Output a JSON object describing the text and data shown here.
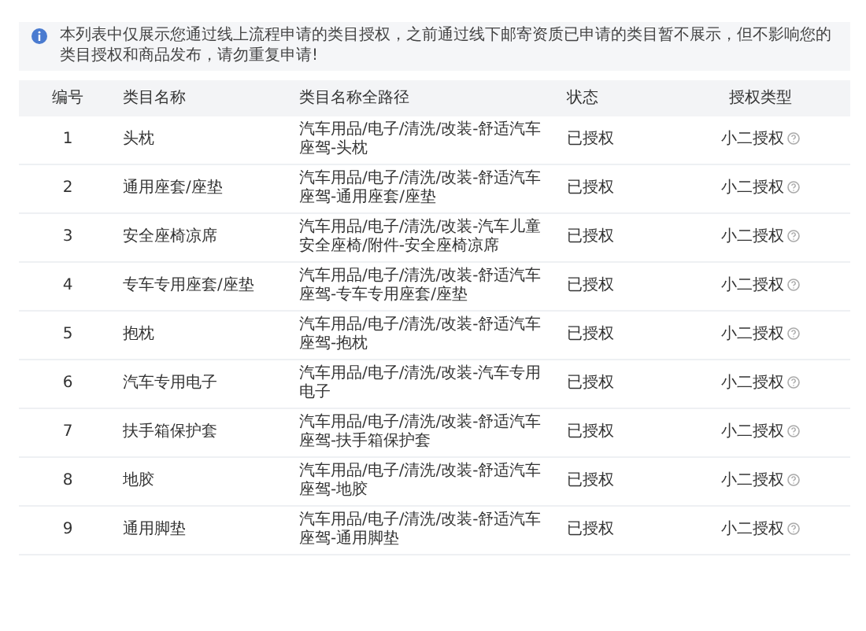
{
  "notice": {
    "text": "本列表中仅展示您通过线上流程申请的类目授权，之前通过线下邮寄资质已申请的类目暂不展示，但不影响您的类目授权和商品发布，请勿重复申请!"
  },
  "table": {
    "columns": [
      "编号",
      "类目名称",
      "类目名称全路径",
      "状态",
      "授权类型"
    ],
    "rows": [
      {
        "no": "1",
        "name": "头枕",
        "path": "汽车用品/电子/清洗/改装-舒适汽车座驾-头枕",
        "status": "已授权",
        "auth_type": "小二授权"
      },
      {
        "no": "2",
        "name": "通用座套/座垫",
        "path": "汽车用品/电子/清洗/改装-舒适汽车座驾-通用座套/座垫",
        "status": "已授权",
        "auth_type": "小二授权"
      },
      {
        "no": "3",
        "name": "安全座椅凉席",
        "path": "汽车用品/电子/清洗/改装-汽车儿童安全座椅/附件-安全座椅凉席",
        "status": "已授权",
        "auth_type": "小二授权"
      },
      {
        "no": "4",
        "name": "专车专用座套/座垫",
        "path": "汽车用品/电子/清洗/改装-舒适汽车座驾-专车专用座套/座垫",
        "status": "已授权",
        "auth_type": "小二授权"
      },
      {
        "no": "5",
        "name": "抱枕",
        "path": "汽车用品/电子/清洗/改装-舒适汽车座驾-抱枕",
        "status": "已授权",
        "auth_type": "小二授权"
      },
      {
        "no": "6",
        "name": "汽车专用电子",
        "path": "汽车用品/电子/清洗/改装-汽车专用电子",
        "status": "已授权",
        "auth_type": "小二授权"
      },
      {
        "no": "7",
        "name": "扶手箱保护套",
        "path": "汽车用品/电子/清洗/改装-舒适汽车座驾-扶手箱保护套",
        "status": "已授权",
        "auth_type": "小二授权"
      },
      {
        "no": "8",
        "name": "地胶",
        "path": "汽车用品/电子/清洗/改装-舒适汽车座驾-地胶",
        "status": "已授权",
        "auth_type": "小二授权"
      },
      {
        "no": "9",
        "name": "通用脚垫",
        "path": "汽车用品/电子/清洗/改装-舒适汽车座驾-通用脚垫",
        "status": "已授权",
        "auth_type": "小二授权"
      }
    ]
  }
}
